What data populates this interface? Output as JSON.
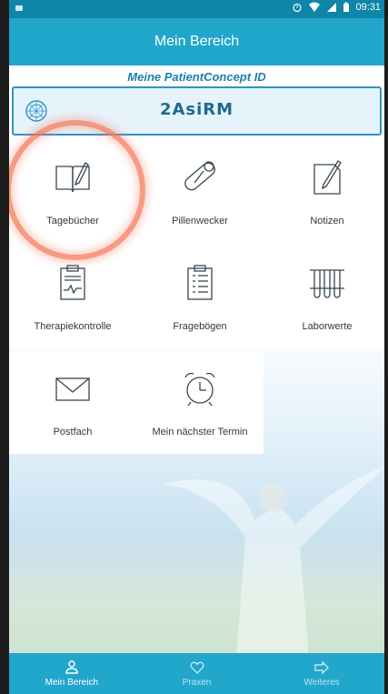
{
  "status_bar": {
    "time": "09:31",
    "icons": [
      "alarm-icon",
      "wifi-icon",
      "signal-icon",
      "battery-icon"
    ]
  },
  "app_bar": {
    "title": "Mein Bereich"
  },
  "patient_id": {
    "label": "Meine PatientConcept ID",
    "value": "2AsiRM"
  },
  "tiles": [
    {
      "label": "Tagebücher",
      "icon": "diary-icon"
    },
    {
      "label": "Pillenwecker",
      "icon": "pill-icon"
    },
    {
      "label": "Notizen",
      "icon": "notes-icon"
    },
    {
      "label": "Therapiekontrolle",
      "icon": "therapy-chart-icon"
    },
    {
      "label": "Fragebögen",
      "icon": "questionnaire-icon"
    },
    {
      "label": "Laborwerte",
      "icon": "lab-tubes-icon"
    },
    {
      "label": "Postfach",
      "icon": "mail-icon"
    },
    {
      "label": "Mein nächster Termin",
      "icon": "alarm-clock-icon"
    }
  ],
  "bottom_nav": [
    {
      "label": "Mein Bereich",
      "icon": "person-icon",
      "active": true
    },
    {
      "label": "Praxen",
      "icon": "heart-icon",
      "active": false
    },
    {
      "label": "Weiteres",
      "icon": "arrow-right-icon",
      "active": false
    }
  ],
  "colors": {
    "primary": "#21a6cc",
    "status_bar": "#0e86a8",
    "highlight_ring": "#f67858",
    "id_text": "#1d6a93"
  }
}
